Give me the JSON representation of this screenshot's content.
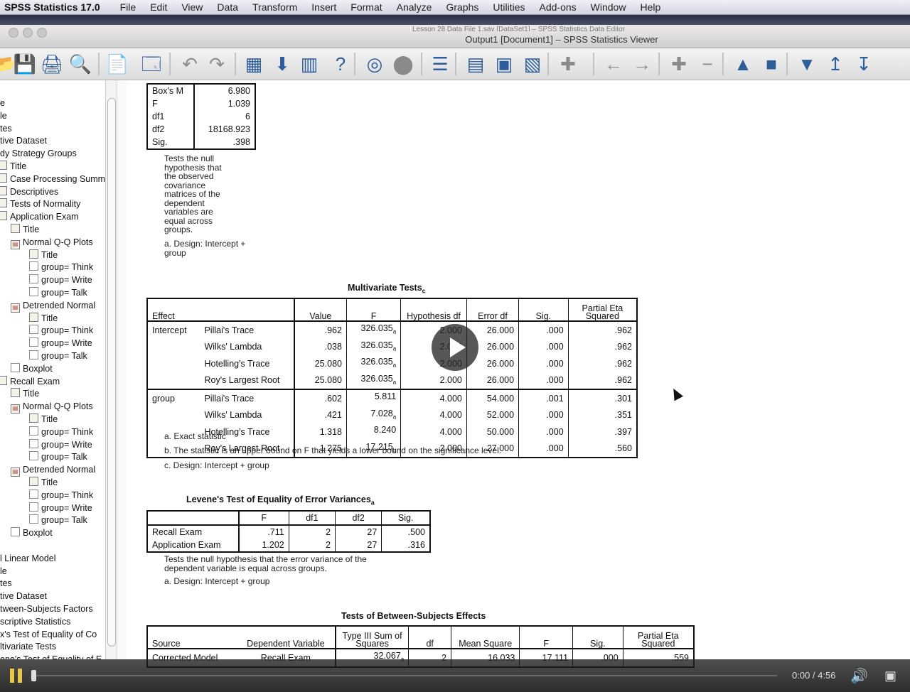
{
  "menubar": {
    "app": "SPSS Statistics 17.0",
    "items": [
      "File",
      "Edit",
      "View",
      "Data",
      "Transform",
      "Insert",
      "Format",
      "Analyze",
      "Graphs",
      "Utilities",
      "Add-ons",
      "Window",
      "Help"
    ]
  },
  "window": {
    "behind_title": "Lesson 28 Data File 1.sav [DataSet1] – SPSS Statistics Data Editor",
    "title": "Output1 [Document1] – SPSS Statistics Viewer"
  },
  "toolbar_icons": [
    "open-icon",
    "save-icon",
    "print-icon",
    "print-preview-icon",
    "export-icon",
    "recall-dialog-icon",
    "undo-icon",
    "redo-icon",
    "goto-data-icon",
    "goto-case-icon",
    "goto-variable-icon",
    "variables-icon",
    "chart-icon",
    "select-cases-icon",
    "designate-window-icon",
    "insert-heading-icon",
    "insert-title-icon",
    "insert-text-icon",
    "insert-chart-icon",
    "promote-icon",
    "demote-icon",
    "expand-icon",
    "collapse-icon",
    "show-icon",
    "hide-icon",
    "designate-icon",
    "first-icon",
    "last-icon"
  ],
  "outline": {
    "items": [
      "e",
      "le",
      "tes",
      "tive Dataset",
      "dy Strategy Groups",
      "Title",
      "Case Processing Summ",
      "Descriptives",
      "Tests of Normality",
      "Application Exam",
      "Title",
      "Normal Q-Q Plots",
      "Title",
      "group= Think",
      "group= Write",
      "group= Talk",
      "Detrended Normal",
      "Title",
      "group= Think",
      "group= Write",
      "group= Talk",
      "Boxplot",
      "Recall Exam",
      "Title",
      "Normal Q-Q Plots",
      "Title",
      "group= Think",
      "group= Write",
      "group= Talk",
      "Detrended Normal",
      "Title",
      "group= Think",
      "group= Write",
      "group= Talk",
      "Boxplot",
      "",
      "l Linear Model",
      "le",
      "tes",
      "tive Dataset",
      "tween-Subjects Factors",
      "scriptive Statistics",
      "x's Test of Equality of Co",
      "ltivariate Tests",
      "ene's Test of Equality of E"
    ]
  },
  "boxm": {
    "rows": [
      [
        "Box's M",
        "6.980"
      ],
      [
        "F",
        "1.039"
      ],
      [
        "df1",
        "6"
      ],
      [
        "df2",
        "18168.923"
      ],
      [
        "Sig.",
        ".398"
      ]
    ],
    "note1": "Tests the null hypothesis that the observed covariance matrices of the dependent variables are equal across groups.",
    "note2": "a. Design: Intercept + group"
  },
  "multivariate": {
    "title": "Multivariate Tests",
    "title_sub": "c",
    "headers": [
      "Effect",
      "",
      "Value",
      "F",
      "Hypothesis df",
      "Error df",
      "Sig.",
      "Partial Eta Squared"
    ],
    "groups": [
      {
        "effect": "Intercept",
        "rows": [
          [
            "Pillai's Trace",
            ".962",
            "326.035",
            "a",
            "2.000",
            "26.000",
            ".000",
            ".962"
          ],
          [
            "Wilks' Lambda",
            ".038",
            "326.035",
            "a",
            "2.000",
            "26.000",
            ".000",
            ".962"
          ],
          [
            "Hotelling's Trace",
            "25.080",
            "326.035",
            "a",
            "2.000",
            "26.000",
            ".000",
            ".962"
          ],
          [
            "Roy's Largest Root",
            "25.080",
            "326.035",
            "a",
            "2.000",
            "26.000",
            ".000",
            ".962"
          ]
        ]
      },
      {
        "effect": "group",
        "rows": [
          [
            "Pillai's Trace",
            ".602",
            "5.811",
            "",
            "4.000",
            "54.000",
            ".001",
            ".301"
          ],
          [
            "Wilks' Lambda",
            ".421",
            "7.028",
            "a",
            "4.000",
            "52.000",
            ".000",
            ".351"
          ],
          [
            "Hotelling's Trace",
            "1.318",
            "8.240",
            "",
            "4.000",
            "50.000",
            ".000",
            ".397"
          ],
          [
            "Roy's Largest Root",
            "1.275",
            "17.215",
            "b",
            "2.000",
            "27.000",
            ".000",
            ".560"
          ]
        ]
      }
    ],
    "notes": [
      "a. Exact statistic",
      "b. The statistic is an upper bound on F that yields a lower bound on the significance level.",
      "c. Design: Intercept + group"
    ]
  },
  "levene": {
    "title": "Levene's Test of Equality of Error Variances",
    "title_sub": "a",
    "headers": [
      "",
      "F",
      "df1",
      "df2",
      "Sig."
    ],
    "rows": [
      [
        "Recall Exam",
        ".711",
        "2",
        "27",
        ".500"
      ],
      [
        "Application Exam",
        "1.202",
        "2",
        "27",
        ".316"
      ]
    ],
    "note1": "Tests the null hypothesis that the error variance of the dependent variable is equal across groups.",
    "note2": "a. Design: Intercept + group"
  },
  "between": {
    "title": "Tests of Between-Subjects Effects",
    "headers": [
      "Source",
      "Dependent Variable",
      "Type III Sum of Squares",
      "df",
      "Mean Square",
      "F",
      "Sig.",
      "Partial Eta Squared"
    ],
    "rows": [
      [
        "Corrected Model",
        "Recall Exam",
        "32.067",
        "a",
        "2",
        "16.033",
        "17.111",
        ".000",
        ".559"
      ]
    ]
  },
  "video": {
    "time": "0:00 / 4:56",
    "progress": 0.0
  }
}
